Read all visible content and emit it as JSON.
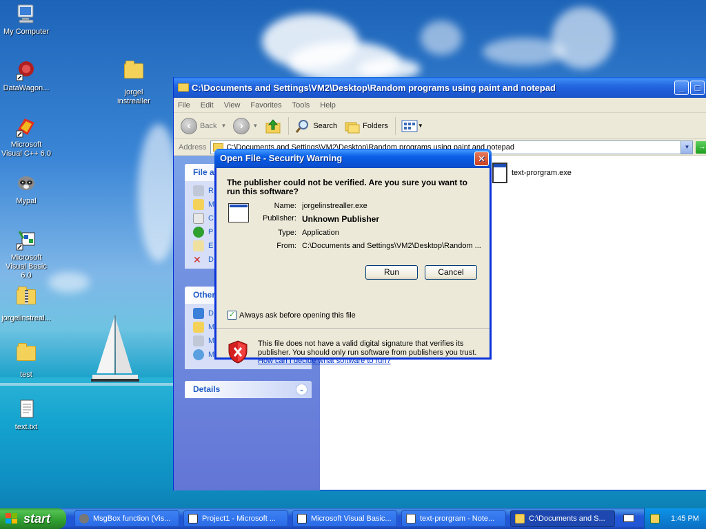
{
  "desktop": {
    "icons": [
      {
        "label": "My Computer"
      },
      {
        "label": "DataWagon..."
      },
      {
        "label": "Microsoft Visual C++ 6.0"
      },
      {
        "label": "Mypal"
      },
      {
        "label": "Microsoft Visual Basic 6.0"
      },
      {
        "label": "jorgelinstreal..."
      },
      {
        "label": "test"
      },
      {
        "label": "text.txt"
      },
      {
        "label": "jorgel instrealler"
      }
    ]
  },
  "explorer": {
    "title": "C:\\Documents and Settings\\VM2\\Desktop\\Random programs using paint and notepad",
    "menu": [
      "File",
      "Edit",
      "View",
      "Favorites",
      "Tools",
      "Help"
    ],
    "toolbar": {
      "back": "Back",
      "search": "Search",
      "folders": "Folders"
    },
    "address_label": "Address",
    "address_value": "C:\\Documents and Settings\\VM2\\Desktop\\Random programs using paint and notepad",
    "go_label": "G",
    "left_panels": {
      "file_tasks": "File a",
      "other_places": "Other",
      "details": "Details"
    },
    "file": {
      "name": "text-prorgram.exe"
    }
  },
  "dialog": {
    "title": "Open File - Security Warning",
    "question": "The publisher could not be verified.  Are you sure you want to run this software?",
    "fields": [
      {
        "key": "Name:",
        "value": "jorgelinstrealler.exe"
      },
      {
        "key": "Publisher:",
        "value": "Unknown Publisher"
      },
      {
        "key": "Type:",
        "value": "Application"
      },
      {
        "key": "From:",
        "value": "C:\\Documents and Settings\\VM2\\Desktop\\Random ..."
      }
    ],
    "run_label": "Run",
    "cancel_label": "Cancel",
    "checkbox_label": "Always ask before opening this file",
    "checkbox_checked": true,
    "warning": "This file does not have a valid digital signature that verifies its publisher.  You should only run software from publishers you trust.",
    "link": "How can I decide what software to run?"
  },
  "taskbar": {
    "start_label": "start",
    "tasks": [
      {
        "label": "MsgBox function (Vis..."
      },
      {
        "label": "Project1 - Microsoft ..."
      },
      {
        "label": "Microsoft Visual Basic..."
      },
      {
        "label": "text-prorgram - Note..."
      },
      {
        "label": "C:\\Documents and S..."
      }
    ],
    "clock": "1:45 PM"
  },
  "colors": {
    "xp_blue": "#0831d9",
    "dialog_bg": "#ece9d8",
    "task_pane": "#6375d6",
    "link": "#0033cc"
  }
}
